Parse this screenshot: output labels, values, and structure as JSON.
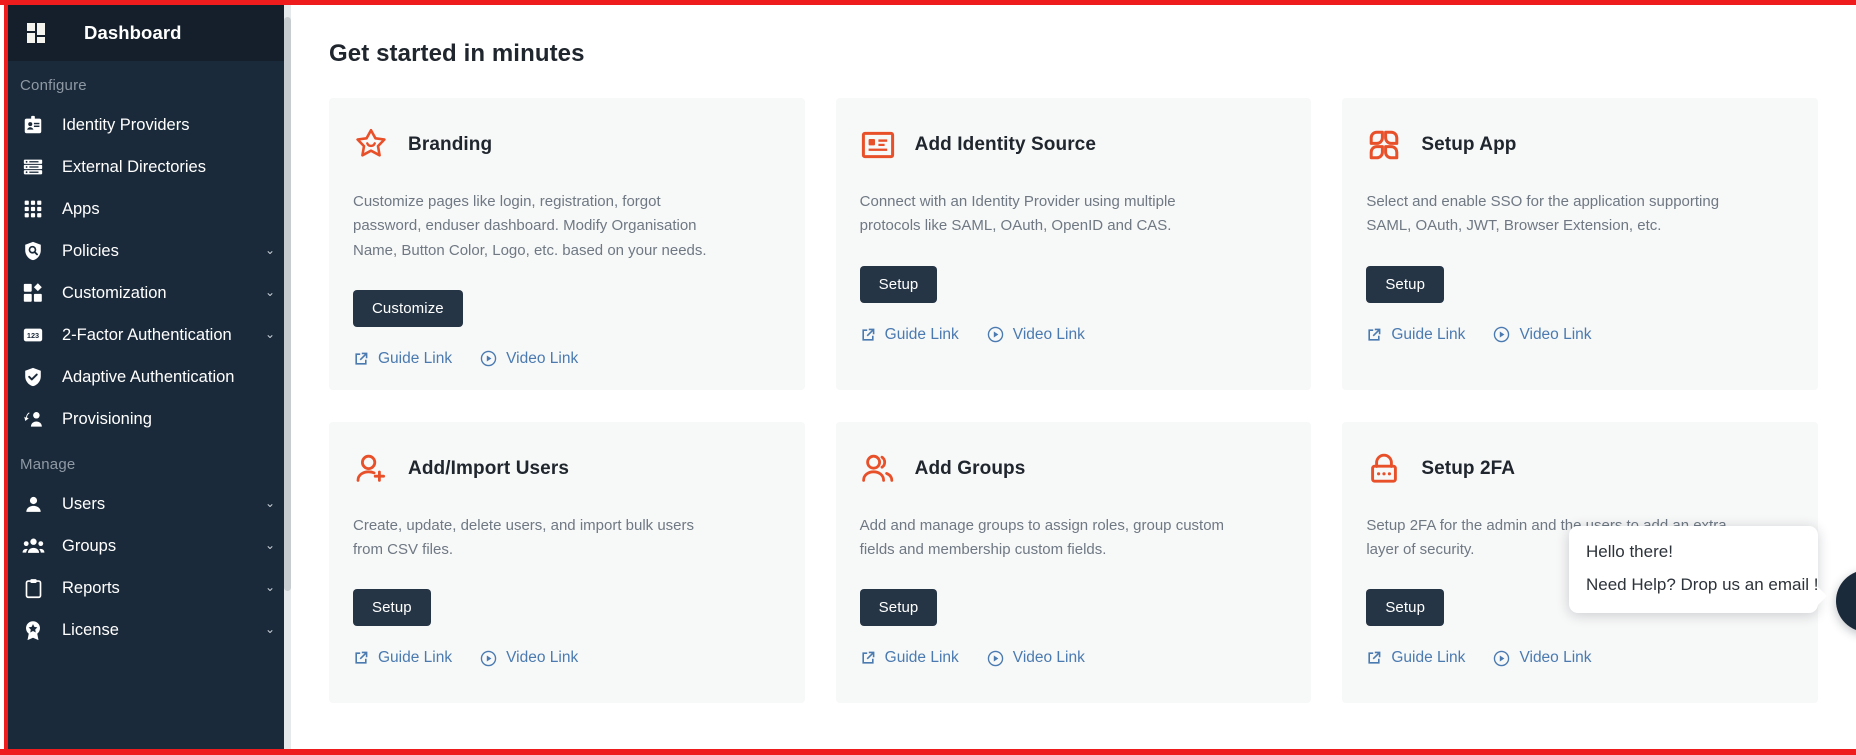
{
  "theme": {
    "accent_orange": "#e8502a",
    "sidebar_bg": "#1b2a3a",
    "sidebar_header_bg": "#141f2b",
    "button_dark": "#253545",
    "link_blue": "#4a7ab0",
    "border_red": "#ee1c1c",
    "card_bg": "#f7f8f8"
  },
  "sidebar": {
    "header": {
      "label": "Dashboard",
      "icon": "dashboard-grid-icon"
    },
    "sections": [
      {
        "label": "Configure",
        "items": [
          {
            "label": "Identity Providers",
            "icon": "id-card-icon",
            "chevron": ""
          },
          {
            "label": "External Directories",
            "icon": "server-list-icon",
            "chevron": ""
          },
          {
            "label": "Apps",
            "icon": "apps-grid-icon",
            "chevron": ""
          },
          {
            "label": "Policies",
            "icon": "shield-search-icon",
            "chevron": "⌄"
          },
          {
            "label": "Customization",
            "icon": "customization-icon",
            "chevron": "⌄"
          },
          {
            "label": "2-Factor Authentication",
            "icon": "numeric-123-icon",
            "chevron": "⌄"
          },
          {
            "label": "Adaptive Authentication",
            "icon": "shield-check-icon",
            "chevron": ""
          },
          {
            "label": "Provisioning",
            "icon": "provisioning-icon",
            "chevron": ""
          }
        ]
      },
      {
        "label": "Manage",
        "items": [
          {
            "label": "Users",
            "icon": "user-icon",
            "chevron": "⌄"
          },
          {
            "label": "Groups",
            "icon": "group-icon",
            "chevron": "⌄"
          },
          {
            "label": "Reports",
            "icon": "clipboard-icon",
            "chevron": "⌄"
          },
          {
            "label": "License",
            "icon": "badge-star-icon",
            "chevron": "⌄"
          }
        ]
      }
    ]
  },
  "main": {
    "title": "Get started in minutes",
    "link_guide_label": "Guide Link",
    "link_video_label": "Video Link",
    "cards": [
      {
        "icon": "star-icon",
        "title": "Branding",
        "description": "Customize pages like login, registration, forgot password, enduser dashboard. Modify Organisation Name, Button Color, Logo, etc. based on your needs.",
        "button": "Customize",
        "guide": "Guide Link",
        "video": "Video Link"
      },
      {
        "icon": "identity-card-icon",
        "title": "Add Identity Source",
        "description": "Connect with an Identity Provider using multiple protocols like SAML, OAuth, OpenID and CAS.",
        "button": "Setup",
        "guide": "Guide Link",
        "video": "Video Link"
      },
      {
        "icon": "app-petals-icon",
        "title": "Setup App",
        "description": "Select and enable SSO for the application supporting SAML, OAuth, JWT, Browser Extension, etc.",
        "button": "Setup",
        "guide": "Guide Link",
        "video": "Video Link"
      },
      {
        "icon": "user-add-icon",
        "title": "Add/Import Users",
        "description": "Create, update, delete users, and import bulk users from CSV files.",
        "button": "Setup",
        "guide": "Guide Link",
        "video": "Video Link"
      },
      {
        "icon": "users-group-icon",
        "title": "Add Groups",
        "description": "Add and manage groups to assign roles, group custom fields and membership custom fields.",
        "button": "Setup",
        "guide": "Guide Link",
        "video": "Video Link"
      },
      {
        "icon": "lock-icon",
        "title": "Setup 2FA",
        "description": "Setup 2FA for the admin and the users to add an extra layer of security.",
        "button": "Setup",
        "guide": "Guide Link",
        "video": "Video Link"
      }
    ]
  },
  "chat": {
    "greeting": "Hello there!",
    "prompt": "Need Help? Drop us an email !",
    "fab_icon": "envelope-icon"
  }
}
